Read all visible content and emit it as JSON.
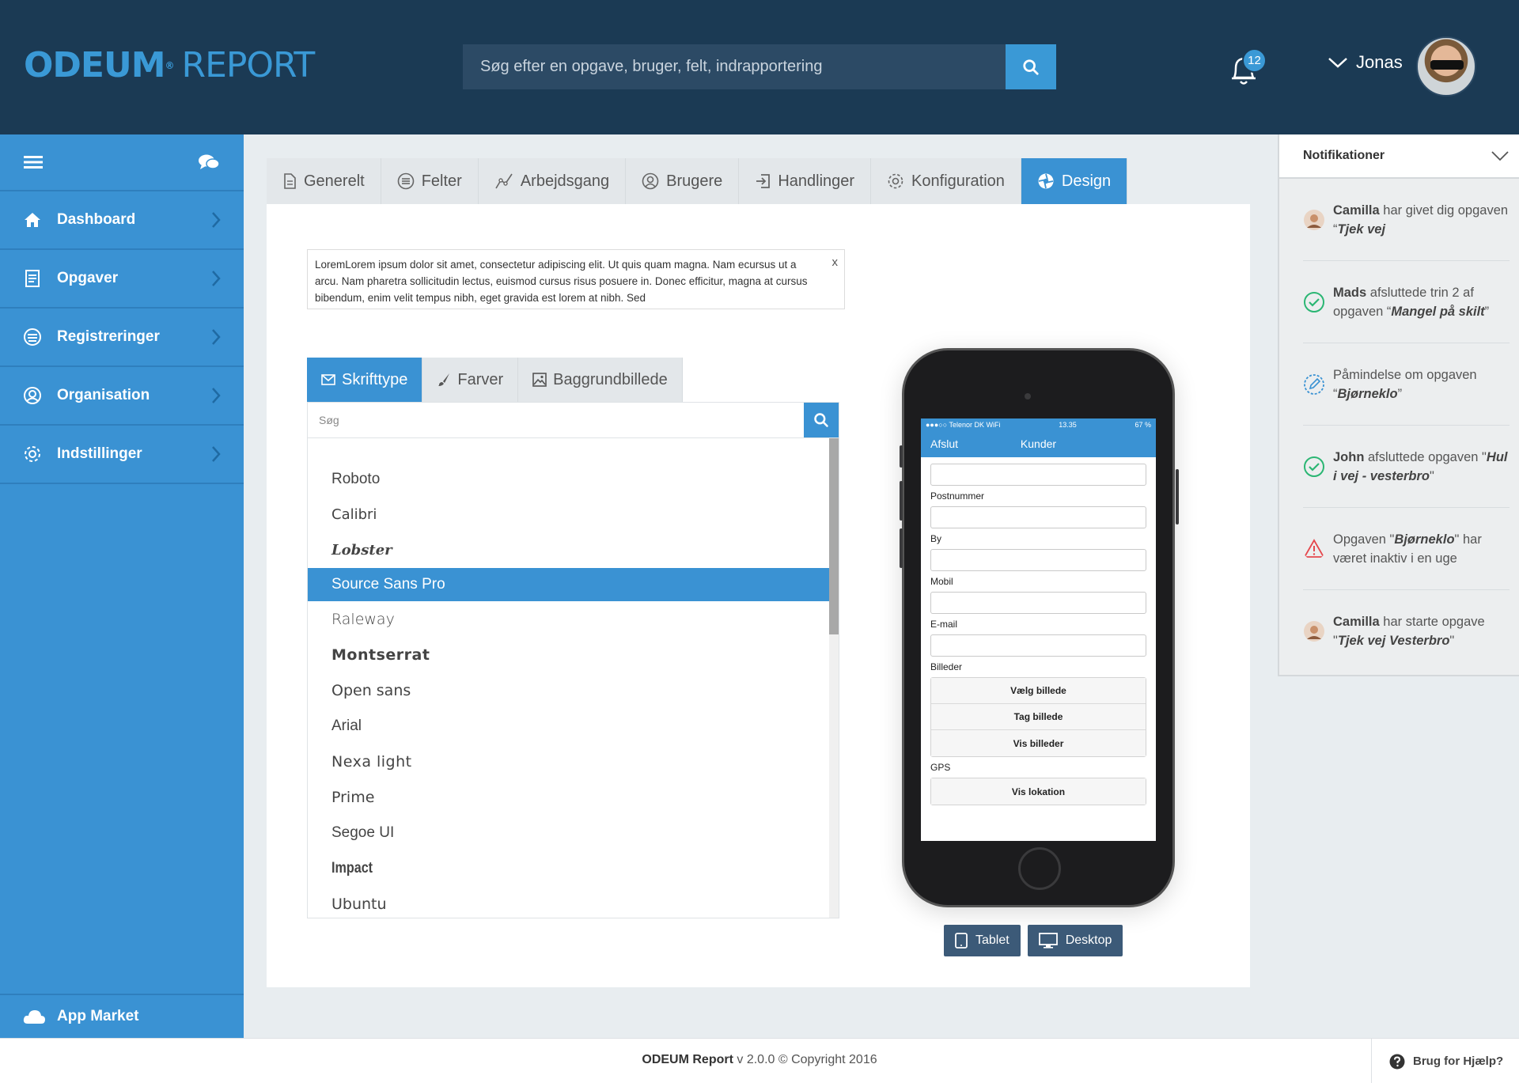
{
  "header": {
    "logo_part1": "ODEUM",
    "logo_reg": "®",
    "logo_part2": "REPORT",
    "search_placeholder": "Søg efter en opgave, bruger, felt, indrapportering",
    "notification_count": "12",
    "user_name": "Jonas"
  },
  "sidebar": {
    "items": [
      {
        "label": "Dashboard",
        "icon": "home-icon"
      },
      {
        "label": "Opgaver",
        "icon": "tasks-icon"
      },
      {
        "label": "Registreringer",
        "icon": "records-icon"
      },
      {
        "label": "Organisation",
        "icon": "user-circle-icon"
      },
      {
        "label": "Indstillinger",
        "icon": "gear-icon"
      }
    ],
    "app_market": "App Market"
  },
  "tabs": [
    {
      "label": "Generelt",
      "icon": "document-icon"
    },
    {
      "label": "Felter",
      "icon": "list-circle-icon"
    },
    {
      "label": "Arbejdsgang",
      "icon": "workflow-icon"
    },
    {
      "label": "Brugere",
      "icon": "user-icon"
    },
    {
      "label": "Handlinger",
      "icon": "sign-in-icon"
    },
    {
      "label": "Konfiguration",
      "icon": "gear-icon"
    },
    {
      "label": "Design",
      "icon": "aperture-icon",
      "active": true
    }
  ],
  "info_box": {
    "text": "LoremLorem ipsum dolor sit amet, consectetur adipiscing elit. Ut quis quam magna. Nam ecursus ut a arcu. Nam pharetra sollicitudin lectus, euismod cursus risus posuere in. Donec efficitur, magna at cursus bibendum, enim velit tempus nibh, eget gravida est lorem at nibh. Sed",
    "close": "x"
  },
  "design": {
    "sub_tabs": [
      {
        "label": "Skrifttype",
        "icon": "envelope-icon",
        "active": true
      },
      {
        "label": "Farver",
        "icon": "brush-icon"
      },
      {
        "label": "Baggrundbillede",
        "icon": "image-icon"
      }
    ],
    "font_search_placeholder": "Søg",
    "fonts": [
      {
        "name": "Roboto"
      },
      {
        "name": "Calibri"
      },
      {
        "name": "Lobster"
      },
      {
        "name": "Source Sans Pro",
        "selected": true
      },
      {
        "name": "Raleway"
      },
      {
        "name": "Montserrat"
      },
      {
        "name": "Open sans"
      },
      {
        "name": "Arial"
      },
      {
        "name": "Nexa light"
      },
      {
        "name": "Prime"
      },
      {
        "name": "Segoe UI"
      },
      {
        "name": "Impact"
      },
      {
        "name": "Ubuntu"
      }
    ]
  },
  "phone": {
    "status_left": "●●●○○ Telenor DK WiFi",
    "status_time": "13.35",
    "status_right": "67 %",
    "back": "Afslut",
    "title": "Kunder",
    "labels": {
      "postnummer": "Postnummer",
      "by": "By",
      "mobil": "Mobil",
      "email": "E-mail",
      "billeder": "Billeder",
      "gps": "GPS"
    },
    "buttons": {
      "choose": "Vælg billede",
      "take": "Tag billede",
      "show": "Vis billeder",
      "location": "Vis lokation"
    }
  },
  "device_buttons": {
    "tablet": "Tablet",
    "desktop": "Desktop"
  },
  "notifications": {
    "title": "Notifikationer",
    "items": [
      {
        "icon": "avatar-icon",
        "name": "Camilla",
        "text": " har givet dig opgaven “",
        "task": "Tjek vej",
        "suffix": ""
      },
      {
        "icon": "check-circle-icon",
        "name": "Mads",
        "text": " afsluttede trin 2 af opgaven “",
        "task": "Mangel på skilt",
        "suffix": "”"
      },
      {
        "icon": "pencil-circle-icon",
        "name": "",
        "text": "Påmindelse om opgaven “",
        "task": "Bjørneklo",
        "suffix": "”"
      },
      {
        "icon": "check-circle-icon",
        "name": "John",
        "text": " afsluttede opgaven \"",
        "task": "Hul i vej - vesterbro",
        "suffix": "\""
      },
      {
        "icon": "warning-icon",
        "name": "",
        "text": "Opgaven \"",
        "task": "Bjørneklo",
        "suffix": "\" har været inaktiv i en uge"
      },
      {
        "icon": "avatar-icon",
        "name": "Camilla",
        "text": " har starte opgave \"",
        "task": "Tjek vej Vesterbro",
        "suffix": "\""
      }
    ]
  },
  "footer": {
    "brand": "ODEUM Report",
    "version": " v 2.0.0 © Copyright 2016",
    "help": "Brug for Hjælp?"
  },
  "colors": {
    "header_bg": "#1b3a54",
    "accent": "#3a92d3",
    "device_button": "#3c5a78",
    "success": "#2bb673",
    "warning": "#e5484d"
  }
}
